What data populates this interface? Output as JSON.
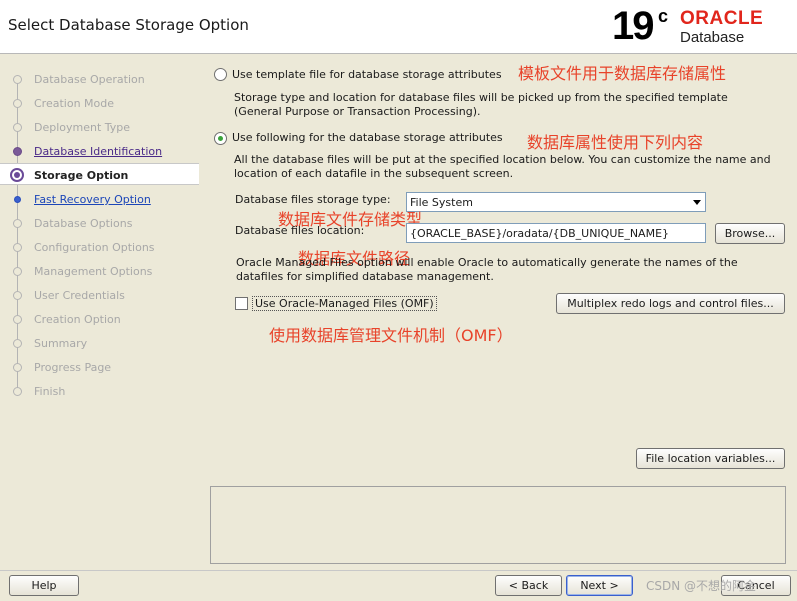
{
  "header": {
    "title": "Select Database Storage Option",
    "logo": {
      "version": "19",
      "version_suffix": "c",
      "brand": "ORACLE",
      "product": "Database"
    }
  },
  "nav": {
    "items": [
      {
        "label": "Database Operation",
        "state": "pending"
      },
      {
        "label": "Creation Mode",
        "state": "pending"
      },
      {
        "label": "Deployment Type",
        "state": "pending"
      },
      {
        "label": "Database Identification",
        "state": "done"
      },
      {
        "label": "Storage Option",
        "state": "current"
      },
      {
        "label": "Fast Recovery Option",
        "state": "link"
      },
      {
        "label": "Database Options",
        "state": "pending"
      },
      {
        "label": "Configuration Options",
        "state": "pending"
      },
      {
        "label": "Management Options",
        "state": "pending"
      },
      {
        "label": "User Credentials",
        "state": "pending"
      },
      {
        "label": "Creation Option",
        "state": "pending"
      },
      {
        "label": "Summary",
        "state": "pending"
      },
      {
        "label": "Progress Page",
        "state": "pending"
      },
      {
        "label": "Finish",
        "state": "pending"
      }
    ]
  },
  "options": {
    "template": {
      "label": "Use template file for database storage attributes",
      "description": "Storage type and location for database files will be picked up from the specified template (General Purpose or Transaction Processing).",
      "annotation": "模板文件用于数据库存储属性",
      "selected": false
    },
    "following": {
      "label": "Use following for the database storage attributes",
      "description": "All the database files will be put at the specified location below. You can customize the name and location of each datafile in the subsequent screen.",
      "annotation": "数据库属性使用下列内容",
      "selected": true
    }
  },
  "storage_type": {
    "label": "Database files storage type:",
    "value": "File System",
    "annotation": "数据库文件存储类型"
  },
  "location": {
    "label": "Database files location:",
    "value": "{ORACLE_BASE}/oradata/{DB_UNIQUE_NAME}",
    "browse_label": "Browse...",
    "annotation": "数据库文件路径"
  },
  "omf": {
    "description": "Oracle Managed Files option will enable Oracle to automatically generate the names of the datafiles for simplified database management.",
    "checkbox_label": "Use Oracle-Managed Files (OMF)",
    "checked": false,
    "annotation": "使用数据库管理文件机制（OMF）",
    "multiplex_label": "Multiplex redo logs and control files..."
  },
  "file_location_variables_label": "File location variables...",
  "footer": {
    "help": "Help",
    "back": "< Back",
    "next": "Next >",
    "cancel": "Cancel",
    "watermark": "CSDN @不想的阿金"
  },
  "colors": {
    "background": "#ece9d8",
    "annotation": "#e8432a",
    "oracle_red": "#e1261c",
    "nav_done": "#4a2a88",
    "nav_link": "#1c46b8"
  }
}
